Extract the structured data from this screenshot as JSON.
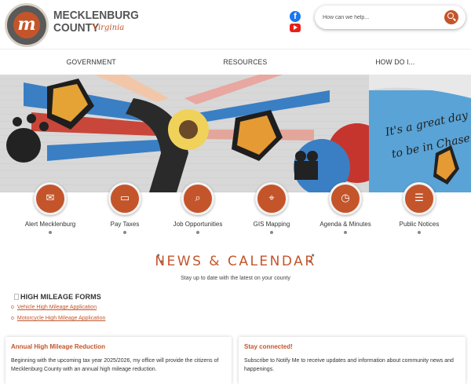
{
  "header": {
    "logo_letter": "m",
    "brand_line1": "MECKLENBURG",
    "brand_line2": "COUNTY",
    "brand_script": "Virginia",
    "social": [
      {
        "name": "facebook-icon",
        "glyph": "f"
      },
      {
        "name": "youtube-icon",
        "glyph": ""
      }
    ],
    "search": {
      "placeholder": "How can we help..."
    }
  },
  "nav": {
    "items": [
      {
        "label": "GOVERNMENT"
      },
      {
        "label": "RESOURCES"
      },
      {
        "label": "HOW DO I..."
      }
    ]
  },
  "hero": {
    "mural_text_line1": "It's a great day",
    "mural_text_line2": "to be in Chase"
  },
  "quick_links": [
    {
      "label": "Alert Mecklenburg",
      "icon": "chat-icon",
      "glyph": "✉"
    },
    {
      "label": "Pay Taxes",
      "icon": "credit-card-icon",
      "glyph": "▭"
    },
    {
      "label": "Job Opportunities",
      "icon": "briefcase-icon",
      "glyph": "⌕"
    },
    {
      "label": "GIS Mapping",
      "icon": "map-icon",
      "glyph": "⌖"
    },
    {
      "label": "Agenda & Minutes",
      "icon": "stopwatch-icon",
      "glyph": "◷"
    },
    {
      "label": "Public Notices",
      "icon": "notice-icon",
      "glyph": "☰"
    }
  ],
  "news": {
    "title": "NEWS & CALENDAR",
    "subtitle": "Stay up to date with the latest on your county"
  },
  "high_mileage": {
    "title": "HIGH MILEAGE FORMS",
    "links": [
      "Vehicle High Mileage Application",
      "Motorcycle High Mileage Application"
    ]
  },
  "cards": [
    {
      "title": "Annual High Mileage Reduction",
      "text": "Beginning with the upcoming tax year 2025/2026, my office will provide the citizens of Mecklenburg County with an annual high mileage reduction."
    },
    {
      "title": "Stay connected!",
      "text": "Subscribe to Notify Me to receive updates and information about community news and happenings."
    }
  ],
  "colors": {
    "accent": "#c4552b",
    "text": "#333333"
  }
}
